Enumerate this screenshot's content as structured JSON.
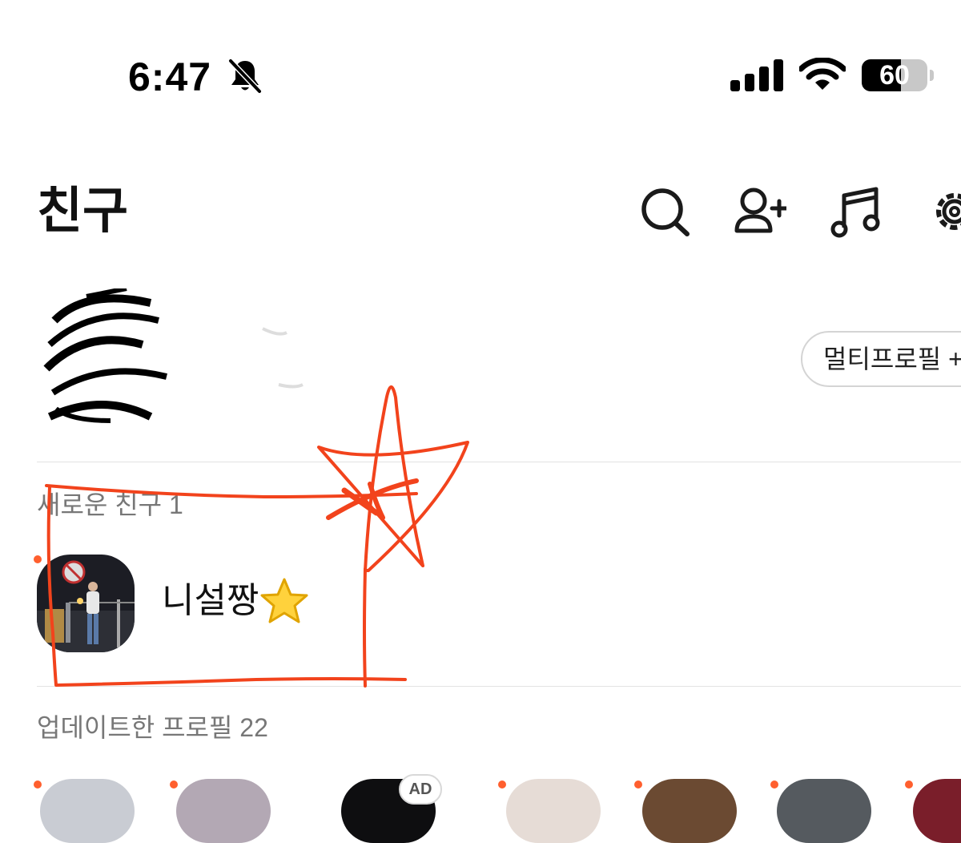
{
  "status_bar": {
    "time": "6:47",
    "battery_percent": 60,
    "battery_label": "60",
    "icons": [
      "bell-slash-icon",
      "cellular-signal-icon",
      "wifi-icon",
      "battery-icon"
    ]
  },
  "header": {
    "title": "친구",
    "icons": [
      "search-icon",
      "add-friend-icon",
      "music-note-icon",
      "gear-icon"
    ]
  },
  "my_profile": {
    "multi_profile_button": "멀티프로필 +"
  },
  "new_friends": {
    "heading": "새로운 친구 1",
    "items": [
      {
        "name": "니설짱"
      }
    ]
  },
  "updated_profiles": {
    "heading": "업데이트한 프로필 22",
    "ad_badge": "AD"
  },
  "colors": {
    "accent_dot": "#ff5f2e",
    "markup_pen": "#f2431c",
    "divider": "#e3e3e3"
  }
}
